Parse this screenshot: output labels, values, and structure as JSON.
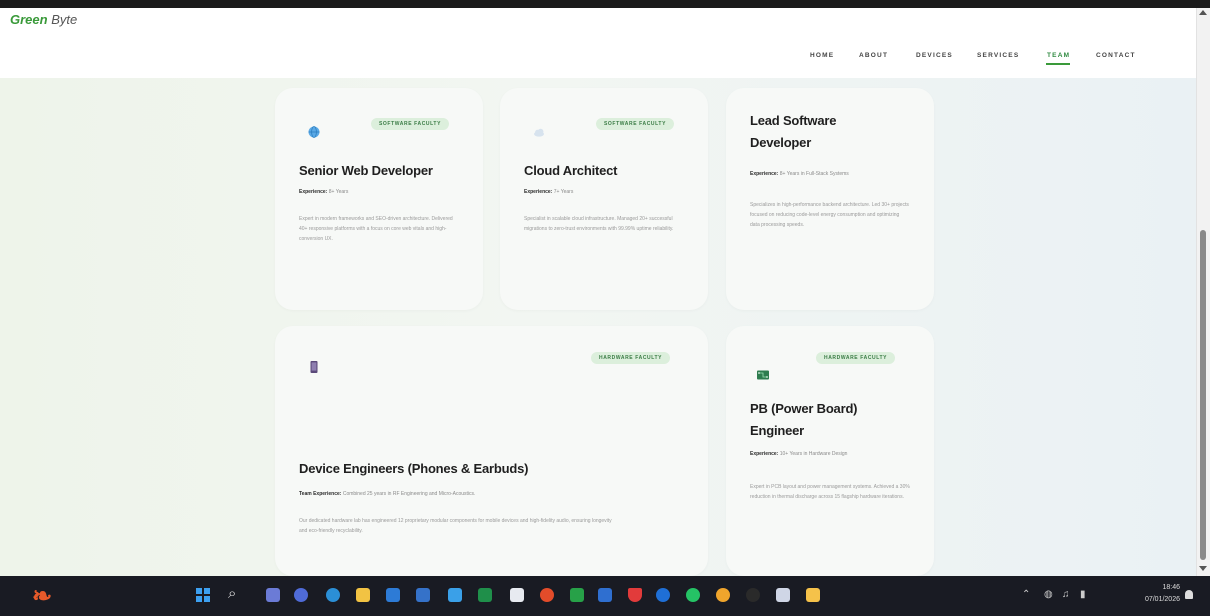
{
  "header": {
    "logo_main": "Green",
    "logo_rest": "Byte",
    "nav": [
      {
        "label": "HOME",
        "active": false
      },
      {
        "label": "ABOUT",
        "active": false
      },
      {
        "label": "DEVICES",
        "active": false
      },
      {
        "label": "SERVICES",
        "active": false
      },
      {
        "label": "TEAM",
        "active": true
      },
      {
        "label": "CONTACT",
        "active": false
      }
    ]
  },
  "cards": [
    {
      "badge": "SOFTWARE FACULTY",
      "icon": "globe-icon",
      "title": "Senior Web Developer",
      "exp_label": "Experience:",
      "exp_value": "8+ Years",
      "desc": "Expert in modern frameworks and SEO-driven architecture. Delivered 40+ responsive platforms with a focus on core web vitals and high-conversion UX."
    },
    {
      "badge": "SOFTWARE FACULTY",
      "icon": "cloud-icon",
      "title": "Cloud Architect",
      "exp_label": "Experience:",
      "exp_value": "7+ Years",
      "desc": "Specialist in scalable cloud infrastructure. Managed 20+ successful migrations to zero-trust environments with 99.99% uptime reliability."
    },
    {
      "badge": "",
      "icon": "",
      "title": "Lead Software Developer",
      "exp_label": "Experience:",
      "exp_value": "8+ Years in Full-Stack Systems",
      "desc": "Specializes in high-performance backend architecture. Led 30+ projects focused on reducing code-level energy consumption and optimizing data processing speeds."
    },
    {
      "badge": "HARDWARE FACULTY",
      "icon": "phone-icon",
      "title": "Device Engineers (Phones & Earbuds)",
      "exp_label": "Team Experience:",
      "exp_value": "Combined 25 years in RF Engineering and Micro-Acoustics.",
      "desc": "Our dedicated hardware lab has engineered 12 proprietary modular components for mobile devices and high-fidelity audio, ensuring longevity and eco-friendly recyclability."
    },
    {
      "badge": "HARDWARE FACULTY",
      "icon": "circuit-board-icon",
      "title": "PB (Power Board) Engineer",
      "exp_label": "Experience:",
      "exp_value": "10+ Years in Hardware Design",
      "desc": "Expert in PCB layout and power management systems. Achieved a 30% reduction in thermal discharge across 15 flagship hardware iterations."
    }
  ],
  "taskbar": {
    "time": "18:46",
    "date": "07/01/2026"
  },
  "colors": {
    "accent": "#3a9a3a",
    "badge_bg": "#dcefdc",
    "taskbar": "#191b23"
  }
}
